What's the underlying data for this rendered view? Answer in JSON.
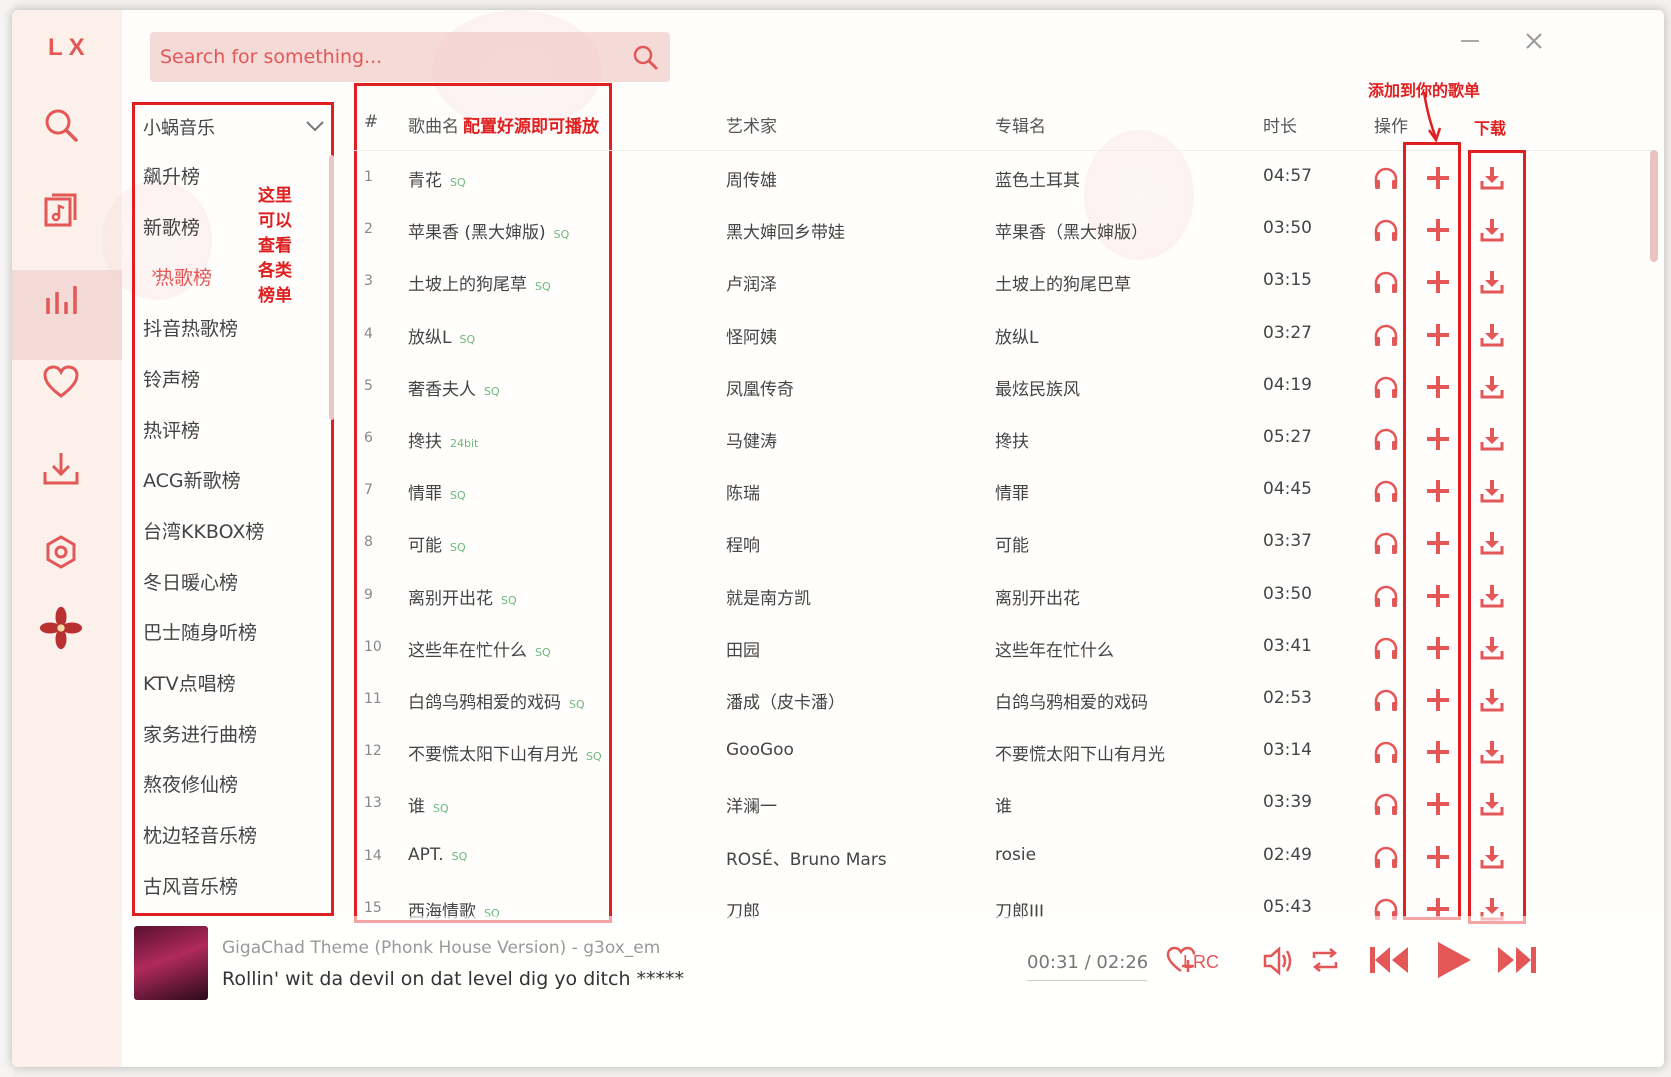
{
  "app": {
    "logo": "LX"
  },
  "sidebar": {
    "nav": [
      {
        "icon": "search-icon"
      },
      {
        "icon": "song-list-icon"
      },
      {
        "icon": "leaderboard-icon"
      },
      {
        "icon": "heart-icon"
      },
      {
        "icon": "download-icon"
      },
      {
        "icon": "settings-icon"
      }
    ]
  },
  "search": {
    "placeholder": "Search for something..."
  },
  "source": {
    "selected": "小蜗音乐"
  },
  "boards": [
    {
      "label": "飙升榜"
    },
    {
      "label": "新歌榜"
    },
    {
      "label": "热歌榜",
      "active": true
    },
    {
      "label": "抖音热歌榜"
    },
    {
      "label": "铃声榜"
    },
    {
      "label": "热评榜"
    },
    {
      "label": "ACG新歌榜"
    },
    {
      "label": "台湾KKBOX榜"
    },
    {
      "label": "冬日暖心榜"
    },
    {
      "label": "巴士随身听榜"
    },
    {
      "label": "KTV点唱榜"
    },
    {
      "label": "家务进行曲榜"
    },
    {
      "label": "熬夜修仙榜"
    },
    {
      "label": "枕边轻音乐榜"
    },
    {
      "label": "古风音乐榜"
    }
  ],
  "annotations": {
    "boards_note": [
      "这里",
      "可以",
      "查看",
      "各类",
      "榜单"
    ],
    "source_note": "配置好源即可播放",
    "add_note": "添加到你的歌单",
    "download_note": "下载"
  },
  "table": {
    "headers": {
      "num": "#",
      "name": "歌曲名",
      "artist": "艺术家",
      "album": "专辑名",
      "duration": "时长",
      "ops": "操作"
    },
    "rows": [
      {
        "num": "1",
        "name": "青花",
        "quality": "SQ",
        "artist": "周传雄",
        "album": "蓝色土耳其",
        "duration": "04:57"
      },
      {
        "num": "2",
        "name": "苹果香 (黑大婶版)",
        "quality": "SQ",
        "artist": "黑大婶回乡带娃",
        "album": "苹果香（黑大婶版）",
        "duration": "03:50"
      },
      {
        "num": "3",
        "name": "土坡上的狗尾草",
        "quality": "SQ",
        "artist": "卢润泽",
        "album": "土坡上的狗尾巴草",
        "duration": "03:15"
      },
      {
        "num": "4",
        "name": "放纵L",
        "quality": "SQ",
        "artist": "怪阿姨",
        "album": "放纵L",
        "duration": "03:27"
      },
      {
        "num": "5",
        "name": "奢香夫人",
        "quality": "SQ",
        "artist": "凤凰传奇",
        "album": "最炫民族风",
        "duration": "04:19"
      },
      {
        "num": "6",
        "name": "搀扶",
        "quality": "24bit",
        "artist": "马健涛",
        "album": "搀扶",
        "duration": "05:27"
      },
      {
        "num": "7",
        "name": "情罪",
        "quality": "SQ",
        "artist": "陈瑞",
        "album": "情罪",
        "duration": "04:45"
      },
      {
        "num": "8",
        "name": "可能",
        "quality": "SQ",
        "artist": "程响",
        "album": "可能",
        "duration": "03:37"
      },
      {
        "num": "9",
        "name": "离别开出花",
        "quality": "SQ",
        "artist": "就是南方凯",
        "album": "离别开出花",
        "duration": "03:50"
      },
      {
        "num": "10",
        "name": "这些年在忙什么",
        "quality": "SQ",
        "artist": "田园",
        "album": "这些年在忙什么",
        "duration": "03:41"
      },
      {
        "num": "11",
        "name": "白鸽乌鸦相爱的戏码",
        "quality": "SQ",
        "artist": "潘成（皮卡潘）",
        "album": "白鸽乌鸦相爱的戏码",
        "duration": "02:53"
      },
      {
        "num": "12",
        "name": "不要慌太阳下山有月光",
        "quality": "SQ",
        "artist": "GooGoo",
        "album": "不要慌太阳下山有月光",
        "duration": "03:14"
      },
      {
        "num": "13",
        "name": "谁",
        "quality": "SQ",
        "artist": "洋澜一",
        "album": "谁",
        "duration": "03:39"
      },
      {
        "num": "14",
        "name": "APT.",
        "quality": "SQ",
        "artist": "ROSÉ、Bruno Mars",
        "album": "rosie",
        "duration": "02:49"
      },
      {
        "num": "15",
        "name": "西海情歌",
        "quality": "SQ",
        "artist": "刀郎",
        "album": "刀郎III",
        "duration": "05:43"
      }
    ]
  },
  "player": {
    "title": "GigaChad Theme (Phonk House Version) - g3ox_em",
    "lyric": "Rollin' wit da devil on dat level dig yo ditch *****",
    "time": "00:31 / 02:26",
    "lrc_label": "LRC"
  },
  "colors": {
    "accent": "#e35757",
    "annotation": "#e02020"
  }
}
